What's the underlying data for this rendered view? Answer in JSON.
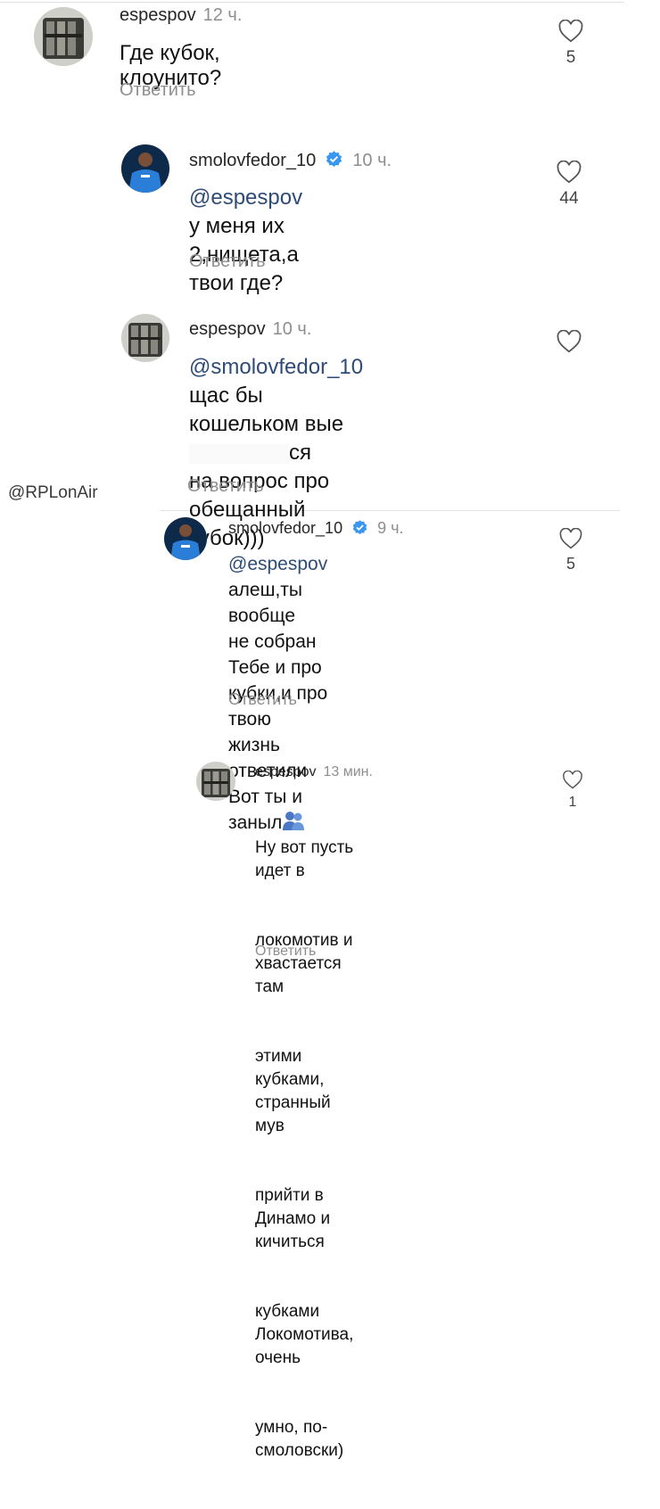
{
  "watermark": "@RPLonAir",
  "comments": [
    {
      "username": "espespov",
      "time": "12 ч.",
      "text": "Где кубок, клоунито?",
      "reply_label": "Ответить",
      "likes": "5",
      "avatar_icon": "bottles-avatar-icon"
    },
    {
      "username": "smolovfedor_10",
      "time": "10 ч.",
      "mention": "@espespov",
      "text_a": " у меня их",
      "text_b": "2,нищета,а твои где?",
      "reply_label": "Ответить",
      "likes": "44",
      "verified": true,
      "avatar_icon": "player-avatar-icon"
    },
    {
      "username": "espespov",
      "time": "10 ч.",
      "mention": "@smolovfedor_10",
      "text_a": " щас бы",
      "text_b": "кошельком вые",
      "text_c": "ся",
      "text_d": "на вопрос про обещанный",
      "text_e": "кубок)))",
      "reply_label": "Ответить",
      "likes": "",
      "avatar_icon": "bottles-avatar-icon"
    },
    {
      "username": "smolovfedor_10",
      "time": "9 ч.",
      "mention": "@espespov",
      "text_a": " алеш,ты вообще",
      "text_b": "не собран",
      "text_c": "Тебе и про кубки,и про твою",
      "text_d": "жизнь ответили",
      "text_e": "Вот ты и заныл",
      "emoji": "two-people-emoji-icon",
      "reply_label": "Ответить",
      "likes": "5",
      "verified": true,
      "avatar_icon": "player-avatar-icon"
    },
    {
      "username": "espespov",
      "time": "13 мин.",
      "lines": [
        "Ну вот пусть идет в",
        "локомотив и хвастается там",
        "этими кубками, странный мув",
        "прийти в Динамо и кичиться",
        "кубками Локомотива, очень",
        "умно, по-смоловски)"
      ],
      "reply_label": "Ответить",
      "likes": "1",
      "avatar_icon": "bottles-avatar-icon"
    }
  ]
}
